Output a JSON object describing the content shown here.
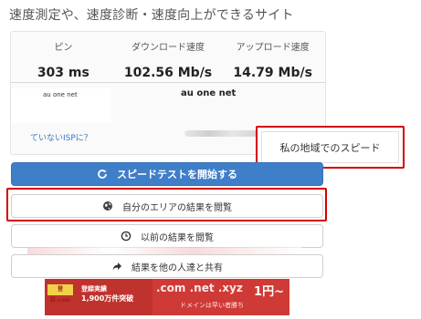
{
  "headline": "速度測定や、速度診断・速度向上ができるサイト",
  "metrics": [
    {
      "label": "ピン",
      "value": "303 ms"
    },
    {
      "label": "ダウンロード速度",
      "value": "102.56 Mb/s"
    },
    {
      "label": "アップロード速度",
      "value": "14.79 Mb/s"
    }
  ],
  "isp": {
    "box_text": "au one net",
    "name": "au one net",
    "link": "ていないISPに？"
  },
  "tooltip": {
    "label": "私の地域でのスピード"
  },
  "buttons": {
    "start": {
      "label": "スピードテストを開始する",
      "icon": "refresh-icon"
    },
    "area": {
      "label": "自分のエリアの結果を閲覧",
      "icon": "globe-icon"
    },
    "previous": {
      "label": "以前の結果を閲覧",
      "icon": "clock-icon"
    },
    "share": {
      "label": "結果を他の人達と共有",
      "icon": "share-icon"
    }
  },
  "ad": {
    "logo": "登録.com",
    "line1": "登録実績",
    "line2": "1,900万件突破",
    "domains": ".com .net .xyz",
    "price": "1円~",
    "sub": "ドメインは早い者勝ち"
  },
  "colors": {
    "primary": "#3f7ec8",
    "highlight": "#d40000",
    "link": "#3a77c2",
    "ad_red": "#cf3a36"
  }
}
